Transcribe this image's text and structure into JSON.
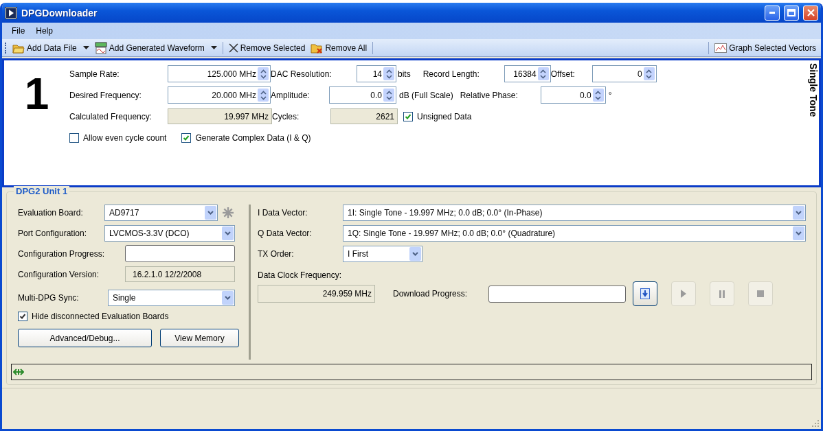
{
  "window": {
    "title": "DPGDownloader"
  },
  "menu": [
    {
      "label": "File"
    },
    {
      "label": "Help"
    }
  ],
  "toolbar": {
    "left": [
      {
        "kind": "split",
        "label": "Add Data File"
      },
      {
        "kind": "split",
        "label": "Add Generated Waveform"
      },
      {
        "kind": "button",
        "label": "Remove Selected"
      },
      {
        "kind": "button",
        "label": "Remove All"
      }
    ],
    "right": [
      {
        "label": "Graph Selected Vectors"
      }
    ]
  },
  "waveform": {
    "number": "1",
    "type_label": "Single Tone",
    "rows": [
      [
        {
          "kind": "label",
          "text": "Sample Rate:"
        },
        {
          "kind": "spin",
          "value": "125.000 MHz"
        },
        {
          "kind": "label",
          "text": "DAC Resolution:"
        },
        {
          "kind": "spin",
          "value": "14"
        },
        {
          "kind": "unit",
          "text": "bits"
        },
        {
          "kind": "label",
          "text": "Record Length:"
        },
        {
          "kind": "spin",
          "value": "16384"
        },
        {
          "kind": "label",
          "text": "Offset:"
        },
        {
          "kind": "spin",
          "value": "0"
        }
      ],
      [
        {
          "kind": "label",
          "text": "Desired Frequency:"
        },
        {
          "kind": "spin",
          "value": "20.000 MHz"
        },
        {
          "kind": "label",
          "text": "Amplitude:"
        },
        {
          "kind": "spin",
          "value": "0.0"
        },
        {
          "kind": "unit",
          "text": "dB (Full Scale)"
        },
        {
          "kind": "label",
          "text": "Relative Phase:"
        },
        {
          "kind": "spin",
          "value": "0.0"
        },
        {
          "kind": "unit",
          "text": "°"
        }
      ],
      [
        {
          "kind": "label",
          "text": "Calculated Frequency:"
        },
        {
          "kind": "readonly",
          "value": "19.997 MHz"
        },
        {
          "kind": "label",
          "text": "Cycles:"
        },
        {
          "kind": "readonly",
          "value": "2621"
        },
        {
          "kind": "checkbox",
          "text": "Unsigned Data",
          "checked": true
        }
      ],
      [
        {
          "kind": "checkbox",
          "text": "Allow even cycle count",
          "checked": false
        },
        {
          "kind": "checkbox",
          "text": "Generate Complex Data (I & Q)",
          "checked": true
        }
      ]
    ]
  },
  "unit": {
    "title": "DPG2 Unit 1",
    "left": [
      {
        "kind": "combo",
        "label": "Evaluation Board:",
        "value": "AD9717"
      },
      {
        "kind": "combo",
        "label": "Port Configuration:",
        "value": "LVCMOS-3.3V (DCO)"
      },
      {
        "kind": "progress",
        "label": "Configuration Progress:",
        "level": 0
      },
      {
        "kind": "readonly",
        "label": "Configuration Version:",
        "value": "16.2.1.0 12/2/2008"
      },
      {
        "kind": "combo",
        "label": "Multi-DPG Sync:",
        "value": "Single"
      }
    ],
    "hide_disconnected": {
      "label": "Hide disconnected Evaluation Boards",
      "checked": true
    },
    "buttons": [
      "Advanced/Debug...",
      "View Memory"
    ],
    "right": [
      {
        "label": "I Data Vector:",
        "value": "1I: Single Tone - 19.997 MHz; 0.0 dB; 0.0° (In-Phase)"
      },
      {
        "label": "Q Data Vector:",
        "value": "1Q: Single Tone - 19.997 MHz; 0.0 dB; 0.0° (Quadrature)"
      },
      {
        "label": "TX Order:",
        "value": "I First"
      }
    ],
    "clock": {
      "label": "Data Clock Frequency:",
      "value": "249.959 MHz"
    },
    "download": {
      "label": "Download Progress:",
      "level": 0,
      "controls": [
        {
          "kind": "download",
          "disabled": false
        },
        {
          "kind": "play",
          "disabled": true
        },
        {
          "kind": "pause",
          "disabled": true
        },
        {
          "kind": "stop",
          "disabled": true
        }
      ]
    }
  }
}
